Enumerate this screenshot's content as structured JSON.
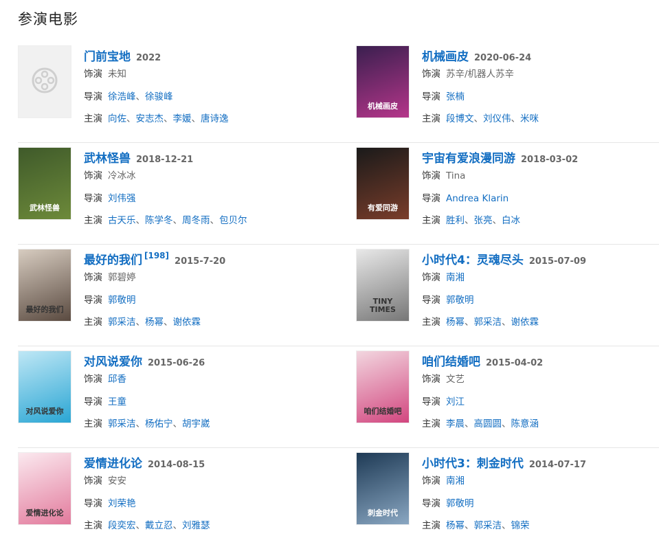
{
  "section_title": "参演电影",
  "labels": {
    "role": "饰演",
    "director": "导演",
    "cast": "主演"
  },
  "sep": "、",
  "movies": [
    {
      "title": "门前宝地",
      "date": "2022",
      "ref": "",
      "role": "未知",
      "role_link": false,
      "directors": [
        "徐浩峰",
        "徐骏峰"
      ],
      "cast": [
        "向佐",
        "安志杰",
        "李媛",
        "唐诗逸"
      ],
      "poster_caption": "",
      "poster_colors": [
        "#f1f1f1",
        "#f1f1f1"
      ],
      "placeholder": true
    },
    {
      "title": "机械画皮",
      "date": "2020-06-24",
      "ref": "",
      "role": "苏辛/机器人苏辛",
      "role_link": false,
      "directors": [
        "张楠"
      ],
      "cast": [
        "段博文",
        "刘仪伟",
        "米咪"
      ],
      "poster_caption": "机械画皮",
      "poster_colors": [
        "#3a1f4f",
        "#b5368a"
      ],
      "placeholder": false
    },
    {
      "title": "武林怪兽",
      "date": "2018-12-21",
      "ref": "",
      "role": "冷冰冰",
      "role_link": false,
      "directors": [
        "刘伟强"
      ],
      "cast": [
        "古天乐",
        "陈学冬",
        "周冬雨",
        "包贝尔"
      ],
      "poster_caption": "武林怪兽",
      "poster_colors": [
        "#3f5a2a",
        "#6d8a3a"
      ],
      "placeholder": false
    },
    {
      "title": "宇宙有爱浪漫同游",
      "date": "2018-03-02",
      "ref": "",
      "role": "Tina",
      "role_link": false,
      "directors": [
        "Andrea Klarin"
      ],
      "cast": [
        "胜利",
        "张亮",
        "白冰"
      ],
      "poster_caption": "有爱同游",
      "poster_colors": [
        "#1a1a1a",
        "#7a3d2a"
      ],
      "placeholder": false
    },
    {
      "title": "最好的我们",
      "date": "2015-7-20",
      "ref": "[198]",
      "role": "郭碧婷",
      "role_link": false,
      "directors": [
        "郭敬明"
      ],
      "cast": [
        "郭采洁",
        "杨幂",
        "谢依霖"
      ],
      "poster_caption": "最好的我们",
      "poster_colors": [
        "#d7ccc0",
        "#5a4a40"
      ],
      "placeholder": false
    },
    {
      "title": "小时代4：灵魂尽头",
      "date": "2015-07-09",
      "ref": "",
      "role": "南湘",
      "role_link": true,
      "directors": [
        "郭敬明"
      ],
      "cast": [
        "杨幂",
        "郭采洁",
        "谢依霖"
      ],
      "poster_caption": "TINY TIMES",
      "poster_colors": [
        "#e8e8e8",
        "#777777"
      ],
      "placeholder": false
    },
    {
      "title": "对风说爱你",
      "date": "2015-06-26",
      "ref": "",
      "role": "邱香",
      "role_link": true,
      "directors": [
        "王童"
      ],
      "cast": [
        "郭采洁",
        "杨佑宁",
        "胡宇崴"
      ],
      "poster_caption": "对风说爱你",
      "poster_colors": [
        "#bfe7f5",
        "#2aa6d4"
      ],
      "placeholder": false
    },
    {
      "title": "咱们结婚吧",
      "date": "2015-04-02",
      "ref": "",
      "role": "文艺",
      "role_link": false,
      "directors": [
        "刘江"
      ],
      "cast": [
        "李晨",
        "高圆圆",
        "陈意涵"
      ],
      "poster_caption": "咱们结婚吧",
      "poster_colors": [
        "#f2d6df",
        "#d2467f"
      ],
      "placeholder": false
    },
    {
      "title": "爱情进化论",
      "date": "2014-08-15",
      "ref": "",
      "role": "安安",
      "role_link": false,
      "directors": [
        "刘荣艳"
      ],
      "cast": [
        "段奕宏",
        "戴立忍",
        "刘雅瑟"
      ],
      "poster_caption": "爱情进化论",
      "poster_colors": [
        "#fbe9ef",
        "#e27a9c"
      ],
      "placeholder": false
    },
    {
      "title": "小时代3：刺金时代",
      "date": "2014-07-17",
      "ref": "",
      "role": "南湘",
      "role_link": true,
      "directors": [
        "郭敬明"
      ],
      "cast": [
        "杨幂",
        "郭采洁",
        "锦荣"
      ],
      "poster_caption": "刺金时代",
      "poster_colors": [
        "#1e3a55",
        "#8aa7c2"
      ],
      "placeholder": false
    }
  ]
}
